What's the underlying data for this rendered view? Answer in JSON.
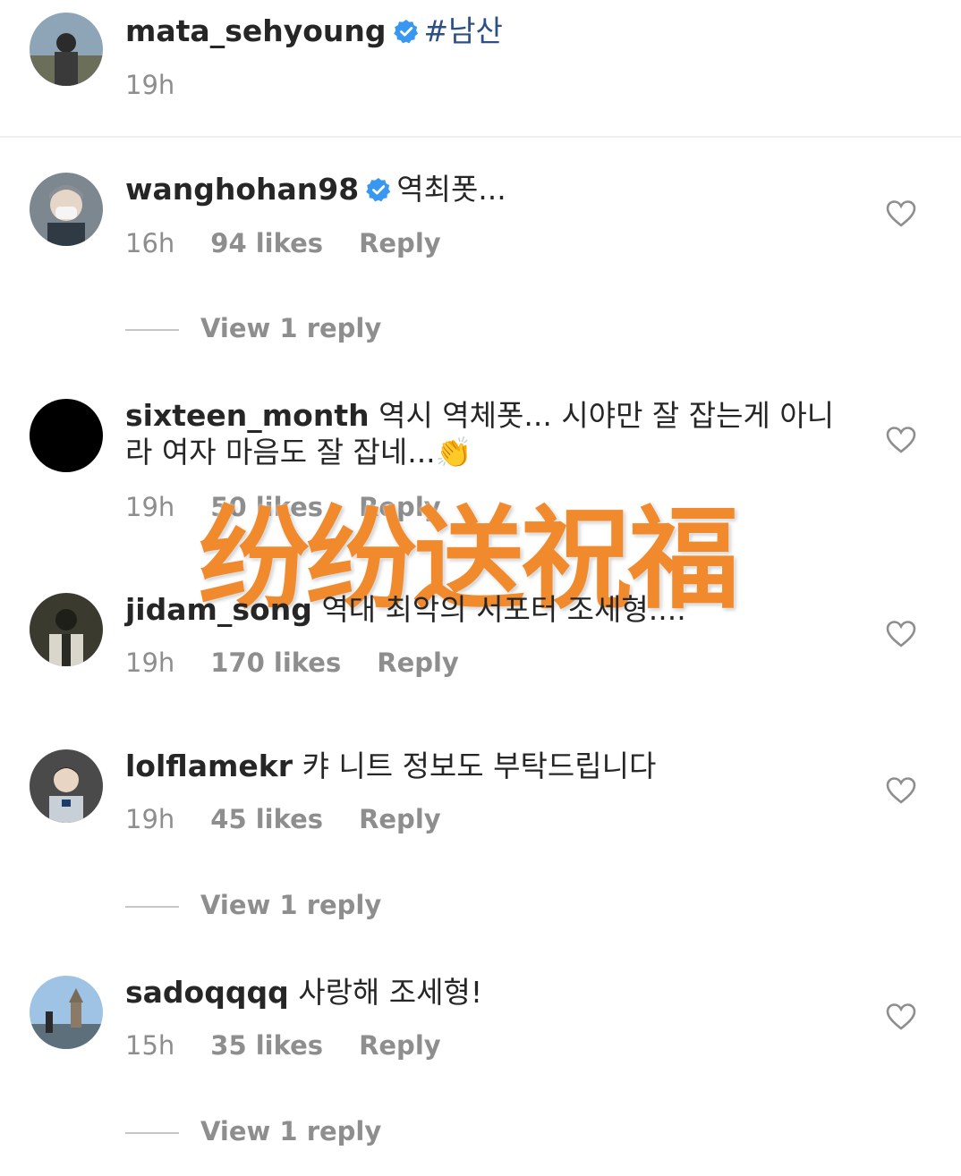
{
  "post": {
    "username": "mata_sehyoung",
    "tag": "#남산",
    "time": "19h"
  },
  "comments": [
    {
      "username": "wanghohan98",
      "verified": true,
      "text": "역최폿...",
      "time": "16h",
      "likes": "94 likes",
      "reply": "Reply",
      "view_replies": "View 1 reply"
    },
    {
      "username": "sixteen_month",
      "verified": false,
      "text": "역시 역체폿... 시야만 잘 잡는게 아니",
      "text2": "라 여자 마음도 잘 잡네...👏",
      "time": "19h",
      "likes": "50 likes",
      "reply": "Reply"
    },
    {
      "username": "jidam_song",
      "verified": false,
      "text": "역대 최악의 서포터 조세형....",
      "time": "19h",
      "likes": "170 likes",
      "reply": "Reply"
    },
    {
      "username": "lolflamekr",
      "verified": false,
      "text": "캬 니트 정보도 부탁드립니다",
      "time": "19h",
      "likes": "45 likes",
      "reply": "Reply",
      "view_replies": "View 1 reply"
    },
    {
      "username": "sadoqqqq",
      "verified": false,
      "text": "사랑해 조세형!",
      "time": "15h",
      "likes": "35 likes",
      "reply": "Reply",
      "view_replies": "View 1 reply"
    }
  ],
  "overlay_text": "纷纷送祝福",
  "icons": {
    "verified": "verified-badge-icon",
    "like": "heart-outline-icon"
  },
  "colors": {
    "verified": "#3897f0",
    "overlay": "#f08a2d",
    "tag": "#2c4f86",
    "muted": "#8e8e8e"
  }
}
